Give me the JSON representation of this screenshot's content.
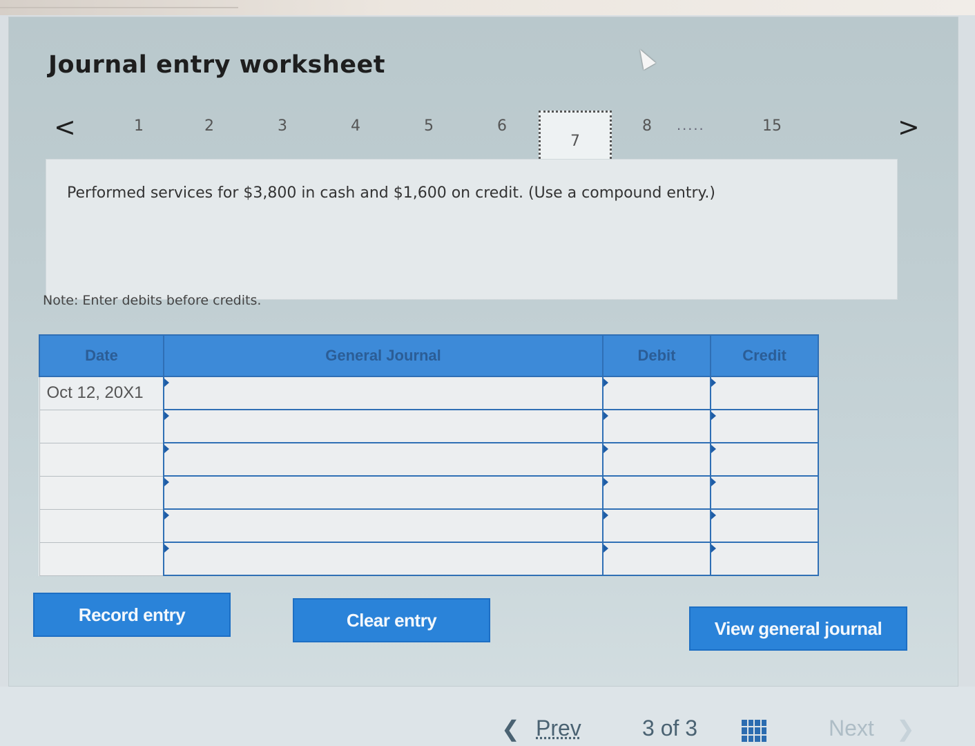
{
  "worksheet": {
    "title": "Journal entry worksheet",
    "pager": {
      "prev_arrow": "<",
      "next_arrow": ">",
      "pages": [
        "1",
        "2",
        "3",
        "4",
        "5",
        "6"
      ],
      "current": "7",
      "after_current": "8",
      "ellipsis": ".....",
      "last": "15"
    },
    "question": "Performed services for $3,800 in cash and $1,600 on credit. (Use a compound entry.)",
    "note": "Note: Enter debits before credits."
  },
  "journal_table": {
    "headers": {
      "date": "Date",
      "general_journal": "General Journal",
      "debit": "Debit",
      "credit": "Credit"
    },
    "rows": [
      {
        "date": "Oct 12, 20X1",
        "account": "",
        "debit": "",
        "credit": ""
      },
      {
        "date": "",
        "account": "",
        "debit": "",
        "credit": ""
      },
      {
        "date": "",
        "account": "",
        "debit": "",
        "credit": ""
      },
      {
        "date": "",
        "account": "",
        "debit": "",
        "credit": ""
      },
      {
        "date": "",
        "account": "",
        "debit": "",
        "credit": ""
      },
      {
        "date": "",
        "account": "",
        "debit": "",
        "credit": ""
      }
    ]
  },
  "buttons": {
    "record": "Record entry",
    "clear": "Clear entry",
    "view": "View general journal"
  },
  "bottom_nav": {
    "prev": "Prev",
    "position": "3 of 3",
    "next": "Next"
  },
  "colors": {
    "accent": "#2a83d9",
    "table_border": "#2f6fb5"
  }
}
